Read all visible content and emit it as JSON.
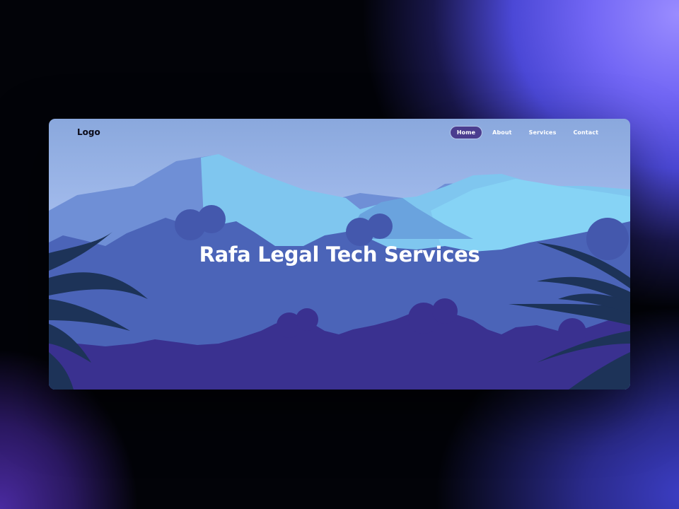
{
  "header": {
    "logo": "Logo",
    "nav": [
      {
        "label": "Home",
        "active": true
      },
      {
        "label": "About",
        "active": false
      },
      {
        "label": "Services",
        "active": false
      },
      {
        "label": "Contact",
        "active": false
      }
    ]
  },
  "hero": {
    "title": "Rafa Legal Tech Services"
  },
  "colors": {
    "sky": "#a5bdee",
    "mountain_back": "#6f8fd6",
    "mountain_light": "#7fc6ef",
    "jungle_mid": "#4b64b8",
    "jungle_front": "#3a3190",
    "leaf_dark": "#1d3358",
    "nav_active": "#4b3d8f"
  }
}
